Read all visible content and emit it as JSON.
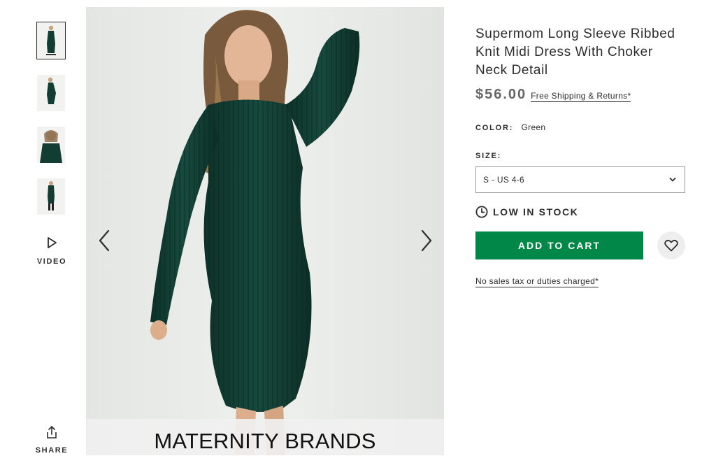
{
  "gallery": {
    "thumbnails": [
      {
        "name": "thumbnail-front",
        "active": true
      },
      {
        "name": "thumbnail-side",
        "active": false
      },
      {
        "name": "thumbnail-closeup",
        "active": false
      },
      {
        "name": "thumbnail-full",
        "active": false
      }
    ],
    "video_label": "VIDEO",
    "share_label": "SHARE",
    "brand_banner": "MATERNITY BRANDS",
    "prev_icon": "chevron-left-icon",
    "next_icon": "chevron-right-icon",
    "dress_color": "#123d33"
  },
  "product": {
    "title": "Supermom Long Sleeve Ribbed Knit Midi Dress With Choker Neck Detail",
    "price": "$56.00",
    "shipping_link": "Free Shipping & Returns*",
    "color_label": "COLOR:",
    "color_value": "Green",
    "size_label": "SIZE:",
    "size_selected": "S - US 4-6",
    "stock_status": "LOW IN STOCK",
    "add_to_cart_label": "ADD TO CART",
    "tax_note": "No sales tax or duties charged*"
  },
  "colors": {
    "accent_green": "#018849",
    "price_gray": "#666666",
    "text": "#2d2d2d"
  }
}
